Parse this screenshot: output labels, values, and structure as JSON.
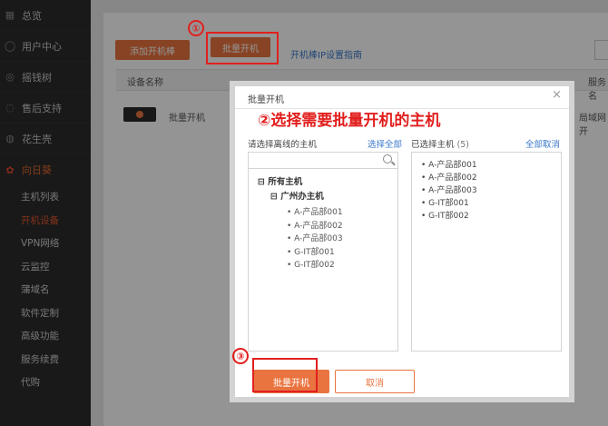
{
  "sidebar": {
    "top_items": [
      {
        "label": "总览",
        "icon": "grid-icon"
      },
      {
        "label": "用户中心",
        "icon": "user-icon"
      },
      {
        "label": "摇钱树",
        "icon": "coin-icon"
      },
      {
        "label": "售后支持",
        "icon": "headset-icon"
      },
      {
        "label": "花生壳",
        "icon": "peanut-icon"
      }
    ],
    "active_parent": {
      "label": "向日葵",
      "icon": "sunflower-icon"
    },
    "sub_items": [
      "主机列表",
      "开机设备",
      "VPN网络",
      "云监控",
      "蒲域名",
      "软件定制",
      "高级功能",
      "服务续费",
      "代购"
    ],
    "active_sub": "开机设备"
  },
  "main": {
    "add_button": "添加开机棒",
    "batch_button": "批量开机",
    "guide_link": "开机棒IP设置指南",
    "col_device": "设备名称",
    "col_service": "服务名",
    "device_name": "批量开机",
    "service_value": "局域网开"
  },
  "dialog": {
    "title": "批量开机",
    "close": "×",
    "left_label": "请选择离线的主机",
    "select_all": "选择全部",
    "right_label": "已选择主机",
    "selected_count": "(5)",
    "deselect_all": "全部取消",
    "tree": {
      "root": "所有主机",
      "group": "广州办主机",
      "hosts": [
        "A-产品部001",
        "A-产品部002",
        "A-产品部003",
        "G-IT部001",
        "G-IT部002"
      ]
    },
    "selected_hosts": [
      "A-产品部001",
      "A-产品部002",
      "A-产品部003",
      "G-IT部001",
      "G-IT部002"
    ],
    "ok_button": "批量开机",
    "cancel_button": "取消"
  },
  "annotations": {
    "step1": "①",
    "step2_text": "②选择需要批量开机的主机",
    "step3": "③",
    "color": "#e1201e"
  }
}
